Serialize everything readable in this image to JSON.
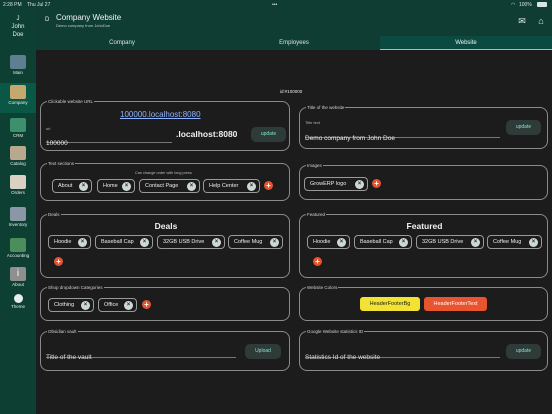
{
  "status": {
    "time": "2:28 PM",
    "date": "Thu Jul 27",
    "battery": "100%"
  },
  "user": {
    "initial": "J",
    "first": "John",
    "last": "Doe"
  },
  "nav": [
    {
      "label": "Main",
      "icon": "main-icon"
    },
    {
      "label": "Company",
      "icon": "company-icon"
    },
    {
      "label": "CRM",
      "icon": "crm-icon"
    },
    {
      "label": "Catalog",
      "icon": "catalog-icon"
    },
    {
      "label": "Orders",
      "icon": "orders-icon"
    },
    {
      "label": "Inventory",
      "icon": "inventory-icon"
    },
    {
      "label": "Accounting",
      "icon": "accounting-icon"
    },
    {
      "label": "About",
      "icon": "about-icon"
    },
    {
      "label": "Theme",
      "icon": "theme-icon"
    }
  ],
  "header": {
    "letter": "D",
    "title": "Company Website",
    "subtitle": "Demo company from JohnDoe"
  },
  "tabs": [
    "Company",
    "Employees",
    "Website"
  ],
  "active_tab": "Website",
  "id_label": "id:#100000",
  "website_url": {
    "label": "Clickable website URL",
    "link": "100000.localhost:8080",
    "field_label": "url",
    "value": "100000",
    "suffix": ".localhost:8080",
    "button": "update"
  },
  "website_title": {
    "label": "Title of the website",
    "field_label": "Title text",
    "value": "Demo company from John Doe",
    "button": "update"
  },
  "text_sections": {
    "label": "Text sections",
    "hint": "Can change order with long press",
    "items": [
      "About",
      "Home",
      "Contact Page",
      "Help Center"
    ]
  },
  "images": {
    "label": "Images",
    "items": [
      "GrowERP logo"
    ]
  },
  "deals": {
    "label": "Deals",
    "heading": "Deals",
    "items": [
      "Hoodie",
      "Baseball Cap",
      "32GB USB Drive",
      "Coffee Mug"
    ]
  },
  "featured": {
    "label": "Featured",
    "heading": "Featured",
    "items": [
      "Hoodie",
      "Baseball Cap",
      "32GB USB Drive",
      "Coffee Mug"
    ]
  },
  "shop_categories": {
    "label": "Shop dropdown Categories",
    "items": [
      "Clothing",
      "Office"
    ]
  },
  "website_colors": {
    "label": "Website Colors",
    "items": [
      "HeaderFooterBg",
      "HeaderFooterText"
    ],
    "colors": [
      "#f2e233",
      "#e8542e"
    ]
  },
  "obsidian": {
    "label": "Obsidian vault",
    "placeholder": "Title of the vault",
    "button": "Upload"
  },
  "stats": {
    "label": "Google Website statistics ID",
    "placeholder": "Statistics Id of the website",
    "button": "update"
  },
  "colors": {
    "accent": "#5ee0c4",
    "sidebar": "#0d3f33",
    "remove": "#e2542f"
  }
}
